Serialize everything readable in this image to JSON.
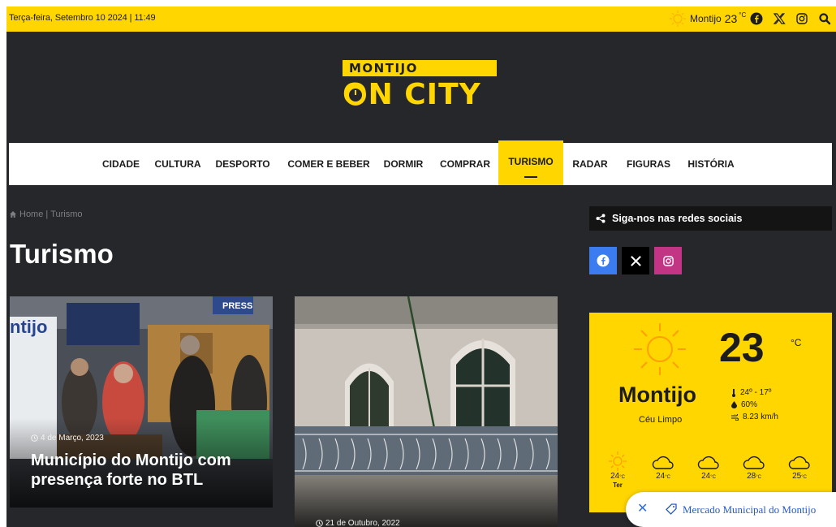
{
  "topbar": {
    "date": "Terça-feira, Setembro 10 2024 | 11:49",
    "weather": {
      "city": "Montijo",
      "temp": "23",
      "unit": "°C",
      "icon": "sun-icon"
    },
    "icons": [
      "facebook-icon",
      "x-icon",
      "instagram-icon",
      "search-icon"
    ]
  },
  "logo": {
    "line1": "MONTIJO",
    "line2": "ON CITY"
  },
  "nav": {
    "items": [
      "CIDADE",
      "CULTURA",
      "DESPORTO",
      "COMER E BEBER",
      "DORMIR",
      "COMPRAR",
      "TURISMO",
      "RADAR",
      "FIGURAS",
      "HISTÓRIA"
    ],
    "active": "TURISMO"
  },
  "breadcrumb": {
    "home": "Home",
    "sep": "|",
    "current": "Turismo"
  },
  "page": {
    "title": "Turismo"
  },
  "cards": [
    {
      "date": "4 de Março, 2023",
      "title": "Município do Montijo com presença forte no BTL",
      "badge": "PRESS"
    },
    {
      "date": "21 de Outubro, 2022"
    }
  ],
  "sidebar": {
    "social_heading": "Siga-nos nas redes sociais",
    "social": [
      {
        "name": "facebook",
        "color": "#3b7cf0"
      },
      {
        "name": "x",
        "color": "#000000"
      },
      {
        "name": "instagram",
        "color": "#c13584"
      }
    ]
  },
  "weather": {
    "temp": "23",
    "unit": "°C",
    "city": "Montijo",
    "description": "Céu Limpo",
    "range": "24º - 17º",
    "humidity": "60%",
    "wind": "8.23 km/h",
    "forecast": [
      {
        "temp": "24",
        "unit": "°C",
        "day": "Ter",
        "icon": "sun-icon"
      },
      {
        "temp": "24",
        "unit": "°C",
        "day": "",
        "icon": "cloud-icon"
      },
      {
        "temp": "24",
        "unit": "°C",
        "day": "",
        "icon": "cloud-icon"
      },
      {
        "temp": "28",
        "unit": "°C",
        "day": "",
        "icon": "cloud-icon"
      },
      {
        "temp": "25",
        "unit": "°C",
        "day": "",
        "icon": "cloud-icon"
      }
    ]
  },
  "popup": {
    "text": "Mercado Municipal do Montijo"
  },
  "colors": {
    "accent": "#ffd600",
    "dark": "#26272b",
    "link": "#2659c9"
  }
}
